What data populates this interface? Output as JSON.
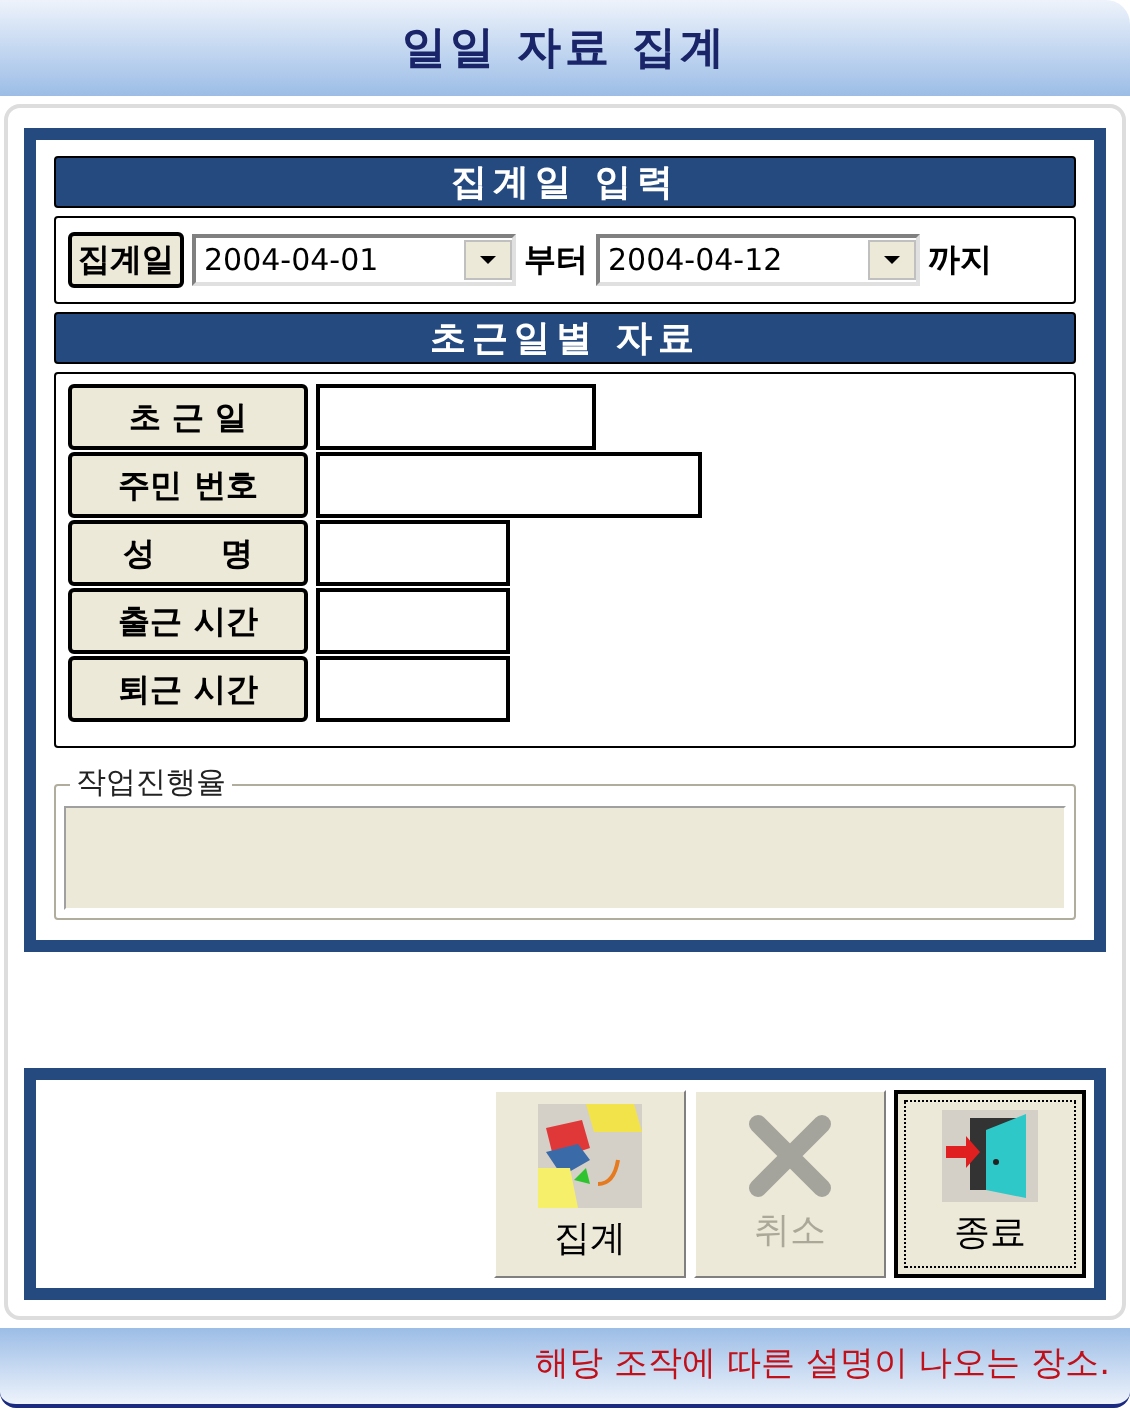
{
  "window": {
    "title": "일일 자료 집계"
  },
  "date_section": {
    "header": "집계일 입력",
    "label": "집계일",
    "from": {
      "value": "2004-04-01"
    },
    "from_suffix": "부터",
    "to": {
      "value": "2004-04-12"
    },
    "to_suffix": "까지"
  },
  "record_section": {
    "header": "초근일별 자료",
    "fields": [
      {
        "label": "초 근 일"
      },
      {
        "label": "주민 번호"
      },
      {
        "label": "성      명"
      },
      {
        "label": "출근 시간"
      },
      {
        "label": "퇴근 시간"
      }
    ]
  },
  "progress": {
    "label": "작업진행율",
    "level": 0
  },
  "buttons": [
    {
      "label": "집계",
      "kind": "aggregate",
      "disabled": false,
      "focused": false
    },
    {
      "label": "취소",
      "kind": "cancel",
      "disabled": true,
      "focused": false
    },
    {
      "label": "종료",
      "kind": "exit",
      "disabled": false,
      "focused": true
    }
  ],
  "status_bar": "해당 조작에 따른 설명이 나오는 장소."
}
